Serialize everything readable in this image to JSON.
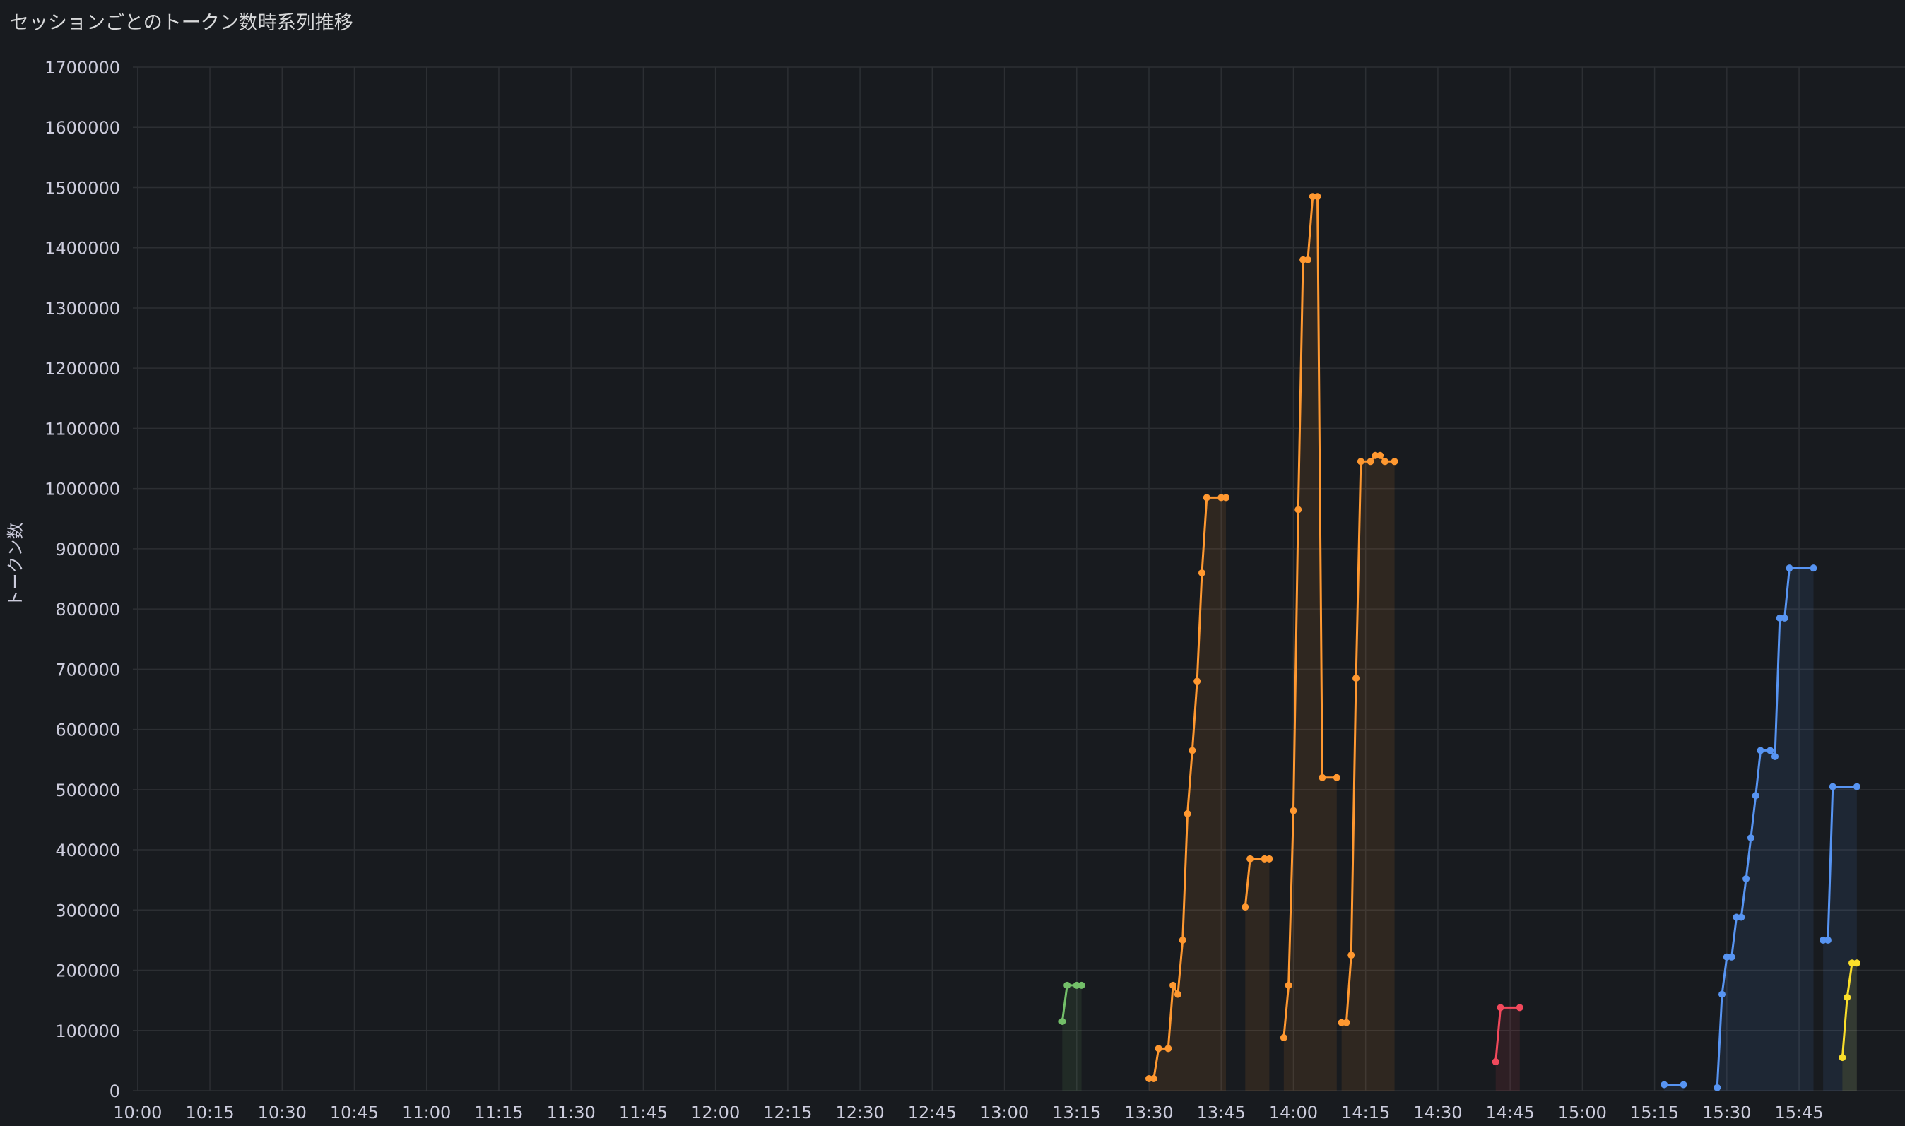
{
  "panel": {
    "title": "セッションごとのトークン数時系列推移"
  },
  "chart_data": {
    "type": "line",
    "title": "セッションごとのトークン数時系列推移",
    "xlabel": "",
    "ylabel": "トークン数",
    "xlim": [
      "09:59",
      "16:07"
    ],
    "ylim": [
      0,
      1700000
    ],
    "grid": true,
    "legend": "none",
    "x_ticks": [
      "10:00",
      "10:15",
      "10:30",
      "10:45",
      "11:00",
      "11:15",
      "11:30",
      "11:45",
      "12:00",
      "12:15",
      "12:30",
      "12:45",
      "13:00",
      "13:15",
      "13:30",
      "13:45",
      "14:00",
      "14:15",
      "14:30",
      "14:45",
      "15:00",
      "15:15",
      "15:30",
      "15:45"
    ],
    "y_ticks": [
      "0",
      "100000",
      "200000",
      "300000",
      "400000",
      "500000",
      "600000",
      "700000",
      "800000",
      "900000",
      "1000000",
      "1100000",
      "1200000",
      "1300000",
      "1400000",
      "1500000",
      "1600000",
      "1700000"
    ],
    "series": [
      {
        "color": "#73bf69",
        "points": [
          [
            "13:12",
            115000
          ],
          [
            "13:13",
            175000
          ],
          [
            "13:15",
            175000
          ],
          [
            "13:16",
            175000
          ]
        ]
      },
      {
        "color": "#ff9830",
        "points": [
          [
            "13:30",
            20000
          ],
          [
            "13:31",
            20000
          ],
          [
            "13:32",
            70000
          ],
          [
            "13:34",
            70000
          ],
          [
            "13:35",
            175000
          ],
          [
            "13:36",
            160000
          ],
          [
            "13:37",
            250000
          ],
          [
            "13:38",
            460000
          ],
          [
            "13:39",
            565000
          ],
          [
            "13:40",
            680000
          ],
          [
            "13:41",
            860000
          ],
          [
            "13:42",
            985000
          ],
          [
            "13:45",
            985000
          ],
          [
            "13:46",
            985000
          ]
        ]
      },
      {
        "color": "#ff9830",
        "points": [
          [
            "13:50",
            305000
          ],
          [
            "13:51",
            385000
          ],
          [
            "13:54",
            385000
          ],
          [
            "13:55",
            385000
          ]
        ]
      },
      {
        "color": "#ff9830",
        "points": [
          [
            "13:58",
            88000
          ],
          [
            "13:59",
            175000
          ],
          [
            "14:00",
            465000
          ],
          [
            "14:01",
            965000
          ],
          [
            "14:02",
            1380000
          ],
          [
            "14:03",
            1380000
          ],
          [
            "14:04",
            1485000
          ],
          [
            "14:05",
            1485000
          ],
          [
            "14:06",
            520000
          ],
          [
            "14:09",
            520000
          ]
        ]
      },
      {
        "color": "#ff9830",
        "points": [
          [
            "14:10",
            113000
          ],
          [
            "14:11",
            113000
          ],
          [
            "14:12",
            225000
          ],
          [
            "14:13",
            685000
          ],
          [
            "14:14",
            1045000
          ],
          [
            "14:16",
            1045000
          ],
          [
            "14:17",
            1055000
          ],
          [
            "14:18",
            1055000
          ],
          [
            "14:19",
            1045000
          ],
          [
            "14:21",
            1045000
          ]
        ]
      },
      {
        "color": "#f2495c",
        "points": [
          [
            "14:42",
            48000
          ],
          [
            "14:43",
            138000
          ],
          [
            "14:47",
            138000
          ]
        ]
      },
      {
        "color": "#5794f2",
        "points": [
          [
            "15:17",
            10000
          ],
          [
            "15:21",
            10000
          ]
        ]
      },
      {
        "color": "#5794f2",
        "points": [
          [
            "15:28",
            5000
          ],
          [
            "15:29",
            160000
          ],
          [
            "15:30",
            222000
          ],
          [
            "15:31",
            222000
          ],
          [
            "15:32",
            288000
          ],
          [
            "15:33",
            288000
          ],
          [
            "15:34",
            352000
          ],
          [
            "15:35",
            420000
          ],
          [
            "15:36",
            490000
          ],
          [
            "15:37",
            565000
          ],
          [
            "15:39",
            565000
          ],
          [
            "15:40",
            555000
          ],
          [
            "15:41",
            785000
          ],
          [
            "15:42",
            785000
          ],
          [
            "15:43",
            868000
          ],
          [
            "15:48",
            868000
          ]
        ]
      },
      {
        "color": "#5794f2",
        "points": [
          [
            "15:50",
            250000
          ],
          [
            "15:51",
            250000
          ],
          [
            "15:52",
            505000
          ],
          [
            "15:57",
            505000
          ]
        ]
      },
      {
        "color": "#fade2a",
        "points": [
          [
            "15:54",
            55000
          ],
          [
            "15:55",
            155000
          ],
          [
            "15:56",
            212000
          ],
          [
            "15:57",
            212000
          ]
        ]
      }
    ]
  }
}
